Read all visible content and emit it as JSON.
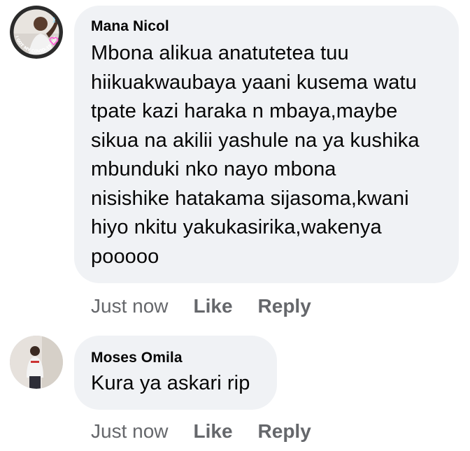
{
  "comments": [
    {
      "author": "Mana Nicol",
      "avatar_badge_text": "I GOT MY COVID-19 VACCINE",
      "text": "Mbona alikua anatutetea tuu\nhiikuakwaubaya yaani kusema watu\ntpate kazi haraka n mbaya,maybe\nsikua na akilii yashule na ya kushika\nmbunduki nko nayo mbona\nnisishike hatakama sijasoma,kwani\nhiyo nkitu yakukasirika,wakenya\npooooo",
      "time": "Just now",
      "like_label": "Like",
      "reply_label": "Reply"
    },
    {
      "author": "Moses Omila",
      "text": "Kura ya askari rip",
      "time": "Just now",
      "like_label": "Like",
      "reply_label": "Reply"
    }
  ],
  "colors": {
    "bubble_bg": "#f0f2f5",
    "meta_text": "#65676b",
    "primary_text": "#050505"
  }
}
